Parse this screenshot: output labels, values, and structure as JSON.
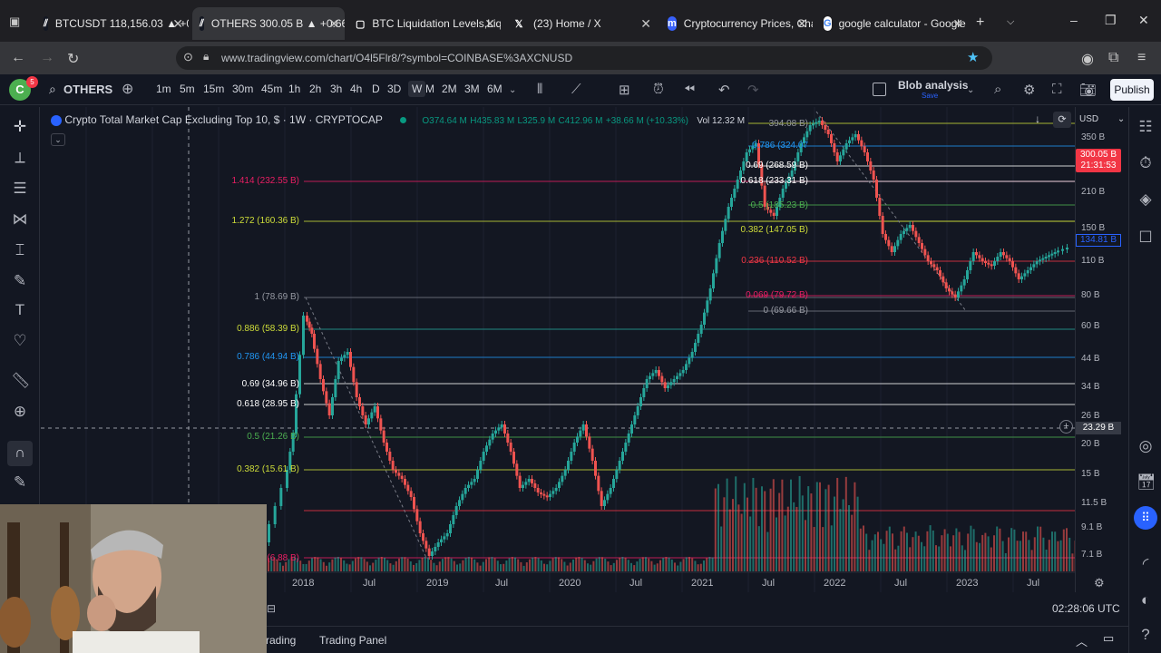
{
  "browser": {
    "tabs": [
      {
        "label": "BTCUSDT 118,156.03 ▲ +0.2",
        "icon": "tradingview-icon",
        "active": false
      },
      {
        "label": "OTHERS 300.05 B ▲ +0.66%",
        "icon": "tradingview-icon",
        "active": true
      },
      {
        "label": "BTC Liquidation Levels,Liqui",
        "icon": "coinglass-icon",
        "active": false
      },
      {
        "label": "(23) Home / X",
        "icon": "x-icon",
        "active": false
      },
      {
        "label": "Cryptocurrency Prices, Chart",
        "icon": "coinmarketcap-icon",
        "active": false
      },
      {
        "label": "google calculator - Google S",
        "icon": "google-icon",
        "active": false
      }
    ],
    "url": "www.tradingview.com/chart/O4l5Flr8/?symbol=COINBASE%3AXCNUSD"
  },
  "toolbar": {
    "avatar_letter": "C",
    "avatar_badge": "5",
    "symbol": "OTHERS",
    "timeframes": [
      "1m",
      "5m",
      "15m",
      "30m",
      "45m",
      "1h",
      "2h",
      "3h",
      "4h",
      "D",
      "3D",
      "W",
      "M",
      "2M",
      "3M",
      "6M"
    ],
    "active_timeframe": "W",
    "layout_name": "Blob analysis",
    "layout_status": "Save",
    "publish_label": "Publish"
  },
  "legend": {
    "title": "Crypto Total Market Cap Excluding Top 10, $ · 1W · CRYPTOCAP",
    "open": "O374.64 M",
    "high": "H435.83 M",
    "low": "L325.9 M",
    "close": "C412.96 M",
    "change": "+38.66 M (+10.33%)",
    "volume": "Vol 12.32 M"
  },
  "fib_left": [
    {
      "label": "1.414 (232.55 B)",
      "color": "#e91e63"
    },
    {
      "label": "1.272 (160.36 B)",
      "color": "#cddc39"
    },
    {
      "label": "1 (78.69 B)",
      "color": "#9598a1"
    },
    {
      "label": "0.886 (58.39 B)",
      "color": "#cddc39"
    },
    {
      "label": "0.786 (44.94 B)",
      "color": "#2196f3"
    },
    {
      "label": "0.69 (34.96 B)",
      "color": "#ffffff"
    },
    {
      "label": "0.618 (28.95 B)",
      "color": "#ffffff"
    },
    {
      "label": "0.5 (21.26 B)",
      "color": "#4caf50"
    },
    {
      "label": "0.382 (15.61 B)",
      "color": "#cddc39"
    },
    {
      "label": "(6.88 B)",
      "color": "#e91e63"
    }
  ],
  "fib_right": [
    {
      "label": "394.08 B)",
      "color": "#9598a1"
    },
    {
      "label": "0.786 (324.07",
      "color": "#2196f3"
    },
    {
      "label": "0.69 (268.59 B)",
      "color": "#ffffff"
    },
    {
      "label": "0.618 (233.31 B)",
      "color": "#ffffff"
    },
    {
      "label": "0.5 (185.23 B)",
      "color": "#4caf50"
    },
    {
      "label": "0.382 (147.05 B)",
      "color": "#cddc39"
    },
    {
      "label": "0.236 (110.52 B)",
      "color": "#f23645"
    },
    {
      "label": "0.069 (79.72 B)",
      "color": "#e91e63"
    },
    {
      "label": "0 (69.66 B)",
      "color": "#9598a1"
    }
  ],
  "price_axis": {
    "currency": "USD",
    "ticks": [
      "350 B",
      "210 B",
      "150 B",
      "110 B",
      "80 B",
      "60 B",
      "44 B",
      "34 B",
      "26 B",
      "20 B",
      "15 B",
      "11.5 B",
      "9.1 B",
      "7.1 B"
    ],
    "last_price": "300.05 B",
    "countdown": "21:31:53",
    "prev_close": "134.81 B",
    "crosshair": "23.29 B"
  },
  "time_axis": {
    "ticks": [
      "2018",
      "Jul",
      "2019",
      "Jul",
      "2020",
      "Jul",
      "2021",
      "Jul",
      "2022",
      "Jul",
      "2023",
      "Jul"
    ]
  },
  "bottom": {
    "clock": "02:28:06 UTC",
    "tabs": [
      "rading",
      "Trading Panel"
    ]
  },
  "colors": {
    "up": "#26a69a",
    "down": "#ef5350",
    "background": "#131722",
    "accent": "#2962ff"
  }
}
